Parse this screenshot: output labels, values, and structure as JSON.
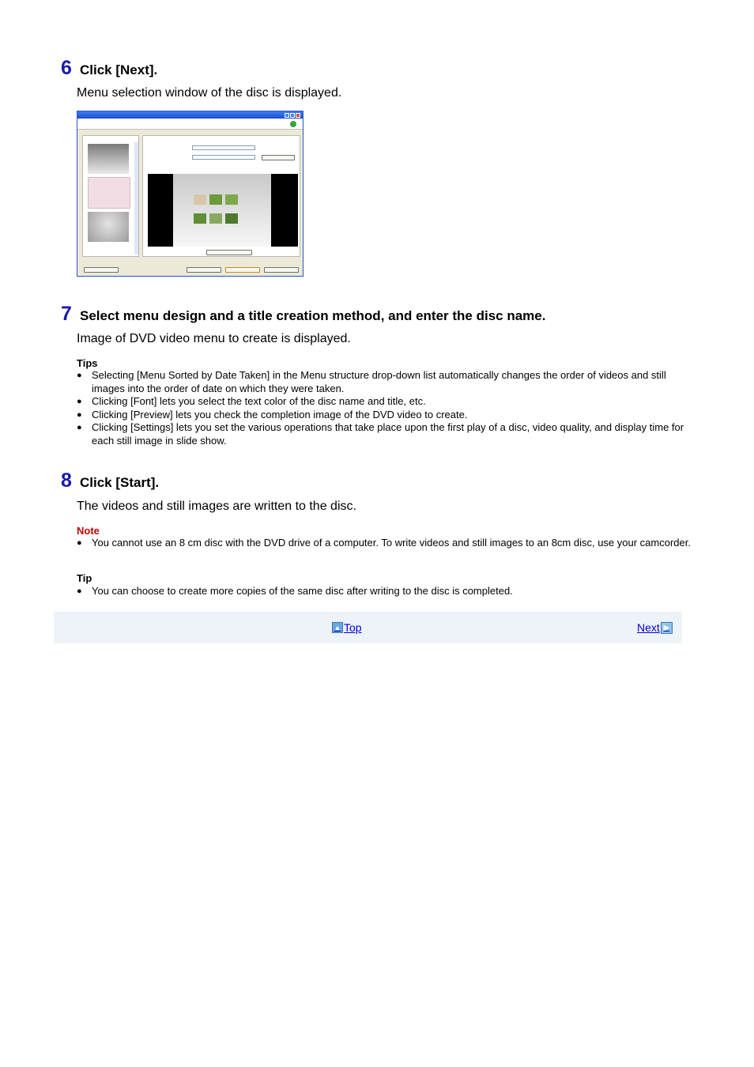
{
  "step6": {
    "number": "6",
    "title": "Click [Next].",
    "description": "Menu selection window of the disc is displayed."
  },
  "step7": {
    "number": "7",
    "title": "Select menu design and a title creation method, and enter the disc name.",
    "description": "Image of DVD video menu to create is displayed.",
    "tips_label": "Tips",
    "tips": [
      "Selecting [Menu Sorted by Date Taken] in the Menu structure drop-down list automatically changes the order of videos and still images into the order of date on which they were taken.",
      "Clicking [Font] lets you select the text color of the disc name and title, etc.",
      "Clicking [Preview] lets you check the completion image of the DVD video to create.",
      "Clicking [Settings] lets you set the various operations that take place upon the first play of a disc, video quality, and display time for each still image in slide show."
    ]
  },
  "step8": {
    "number": "8",
    "title": "Click [Start].",
    "description": "The videos and still images are written to the disc.",
    "note_label": "Note",
    "notes": [
      "You cannot use an 8 cm disc with the DVD drive of a computer. To write videos and still images to an 8cm disc, use your camcorder."
    ],
    "tip_label": "Tip",
    "tip": [
      "You can choose to create more copies of the same disc after writing to the disc is completed."
    ]
  },
  "nav": {
    "top_label": "Top",
    "next_label": "Next"
  },
  "colors": {
    "step_number": "#1a1aa8",
    "note_label": "#c00000",
    "link": "#0000cc",
    "nav_background": "#eef2f9"
  }
}
